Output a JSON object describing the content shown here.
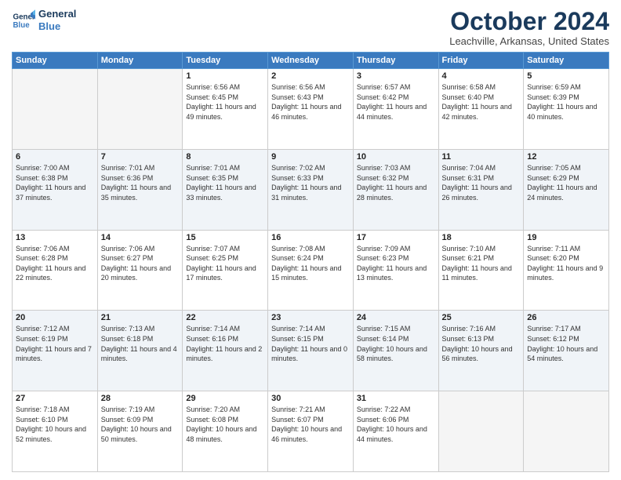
{
  "header": {
    "logo_line1": "General",
    "logo_line2": "Blue",
    "title": "October 2024",
    "location": "Leachville, Arkansas, United States"
  },
  "days_of_week": [
    "Sunday",
    "Monday",
    "Tuesday",
    "Wednesday",
    "Thursday",
    "Friday",
    "Saturday"
  ],
  "weeks": [
    [
      {
        "day": "",
        "info": ""
      },
      {
        "day": "",
        "info": ""
      },
      {
        "day": "1",
        "info": "Sunrise: 6:56 AM\nSunset: 6:45 PM\nDaylight: 11 hours and 49 minutes."
      },
      {
        "day": "2",
        "info": "Sunrise: 6:56 AM\nSunset: 6:43 PM\nDaylight: 11 hours and 46 minutes."
      },
      {
        "day": "3",
        "info": "Sunrise: 6:57 AM\nSunset: 6:42 PM\nDaylight: 11 hours and 44 minutes."
      },
      {
        "day": "4",
        "info": "Sunrise: 6:58 AM\nSunset: 6:40 PM\nDaylight: 11 hours and 42 minutes."
      },
      {
        "day": "5",
        "info": "Sunrise: 6:59 AM\nSunset: 6:39 PM\nDaylight: 11 hours and 40 minutes."
      }
    ],
    [
      {
        "day": "6",
        "info": "Sunrise: 7:00 AM\nSunset: 6:38 PM\nDaylight: 11 hours and 37 minutes."
      },
      {
        "day": "7",
        "info": "Sunrise: 7:01 AM\nSunset: 6:36 PM\nDaylight: 11 hours and 35 minutes."
      },
      {
        "day": "8",
        "info": "Sunrise: 7:01 AM\nSunset: 6:35 PM\nDaylight: 11 hours and 33 minutes."
      },
      {
        "day": "9",
        "info": "Sunrise: 7:02 AM\nSunset: 6:33 PM\nDaylight: 11 hours and 31 minutes."
      },
      {
        "day": "10",
        "info": "Sunrise: 7:03 AM\nSunset: 6:32 PM\nDaylight: 11 hours and 28 minutes."
      },
      {
        "day": "11",
        "info": "Sunrise: 7:04 AM\nSunset: 6:31 PM\nDaylight: 11 hours and 26 minutes."
      },
      {
        "day": "12",
        "info": "Sunrise: 7:05 AM\nSunset: 6:29 PM\nDaylight: 11 hours and 24 minutes."
      }
    ],
    [
      {
        "day": "13",
        "info": "Sunrise: 7:06 AM\nSunset: 6:28 PM\nDaylight: 11 hours and 22 minutes."
      },
      {
        "day": "14",
        "info": "Sunrise: 7:06 AM\nSunset: 6:27 PM\nDaylight: 11 hours and 20 minutes."
      },
      {
        "day": "15",
        "info": "Sunrise: 7:07 AM\nSunset: 6:25 PM\nDaylight: 11 hours and 17 minutes."
      },
      {
        "day": "16",
        "info": "Sunrise: 7:08 AM\nSunset: 6:24 PM\nDaylight: 11 hours and 15 minutes."
      },
      {
        "day": "17",
        "info": "Sunrise: 7:09 AM\nSunset: 6:23 PM\nDaylight: 11 hours and 13 minutes."
      },
      {
        "day": "18",
        "info": "Sunrise: 7:10 AM\nSunset: 6:21 PM\nDaylight: 11 hours and 11 minutes."
      },
      {
        "day": "19",
        "info": "Sunrise: 7:11 AM\nSunset: 6:20 PM\nDaylight: 11 hours and 9 minutes."
      }
    ],
    [
      {
        "day": "20",
        "info": "Sunrise: 7:12 AM\nSunset: 6:19 PM\nDaylight: 11 hours and 7 minutes."
      },
      {
        "day": "21",
        "info": "Sunrise: 7:13 AM\nSunset: 6:18 PM\nDaylight: 11 hours and 4 minutes."
      },
      {
        "day": "22",
        "info": "Sunrise: 7:14 AM\nSunset: 6:16 PM\nDaylight: 11 hours and 2 minutes."
      },
      {
        "day": "23",
        "info": "Sunrise: 7:14 AM\nSunset: 6:15 PM\nDaylight: 11 hours and 0 minutes."
      },
      {
        "day": "24",
        "info": "Sunrise: 7:15 AM\nSunset: 6:14 PM\nDaylight: 10 hours and 58 minutes."
      },
      {
        "day": "25",
        "info": "Sunrise: 7:16 AM\nSunset: 6:13 PM\nDaylight: 10 hours and 56 minutes."
      },
      {
        "day": "26",
        "info": "Sunrise: 7:17 AM\nSunset: 6:12 PM\nDaylight: 10 hours and 54 minutes."
      }
    ],
    [
      {
        "day": "27",
        "info": "Sunrise: 7:18 AM\nSunset: 6:10 PM\nDaylight: 10 hours and 52 minutes."
      },
      {
        "day": "28",
        "info": "Sunrise: 7:19 AM\nSunset: 6:09 PM\nDaylight: 10 hours and 50 minutes."
      },
      {
        "day": "29",
        "info": "Sunrise: 7:20 AM\nSunset: 6:08 PM\nDaylight: 10 hours and 48 minutes."
      },
      {
        "day": "30",
        "info": "Sunrise: 7:21 AM\nSunset: 6:07 PM\nDaylight: 10 hours and 46 minutes."
      },
      {
        "day": "31",
        "info": "Sunrise: 7:22 AM\nSunset: 6:06 PM\nDaylight: 10 hours and 44 minutes."
      },
      {
        "day": "",
        "info": ""
      },
      {
        "day": "",
        "info": ""
      }
    ]
  ]
}
